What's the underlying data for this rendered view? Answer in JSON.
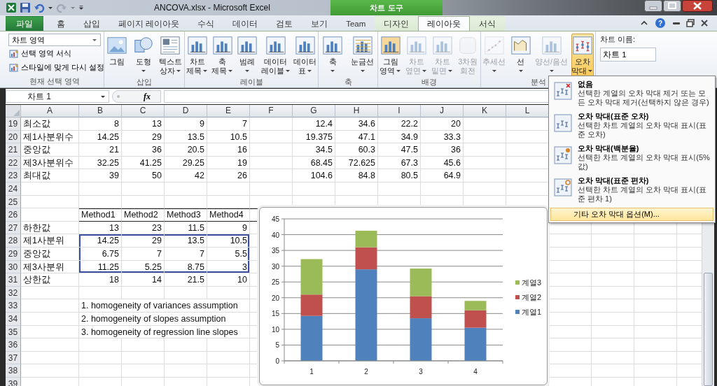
{
  "window": {
    "title": "ANCOVA.xlsx  -  Microsoft Excel",
    "context_group": "차트 도구",
    "help": "?"
  },
  "tabs": [
    {
      "label": "파일",
      "selected": false,
      "kind": "file"
    },
    {
      "label": "홈",
      "selected": false,
      "kind": "main"
    },
    {
      "label": "삽입",
      "selected": false,
      "kind": "main"
    },
    {
      "label": "페이지 레이아웃",
      "selected": false,
      "kind": "main"
    },
    {
      "label": "수식",
      "selected": false,
      "kind": "main"
    },
    {
      "label": "데이터",
      "selected": false,
      "kind": "main"
    },
    {
      "label": "검토",
      "selected": false,
      "kind": "main"
    },
    {
      "label": "보기",
      "selected": false,
      "kind": "main"
    },
    {
      "label": "Team",
      "selected": false,
      "kind": "main"
    },
    {
      "label": "디자인",
      "selected": false,
      "kind": "context"
    },
    {
      "label": "레이아웃",
      "selected": true,
      "kind": "context"
    },
    {
      "label": "서식",
      "selected": false,
      "kind": "context"
    }
  ],
  "ribbon": {
    "selection_group": {
      "label": "현재 선택 영역",
      "dropdown": "차트 영역",
      "items": [
        "선택 영역 서식",
        "스타일에 맞게 다시 설정"
      ]
    },
    "groups": [
      {
        "label": "삽입",
        "buttons": [
          {
            "lines": [
              "그림"
            ],
            "dropdown": false,
            "disabled": false,
            "selected": false
          },
          {
            "lines": [
              "도형"
            ],
            "dropdown": true,
            "disabled": false,
            "selected": false
          },
          {
            "lines": [
              "텍스트",
              "상자"
            ],
            "dropdown": true,
            "disabled": false,
            "selected": false
          }
        ]
      },
      {
        "label": "레이블",
        "buttons": [
          {
            "lines": [
              "차트",
              "제목"
            ],
            "dropdown": true,
            "disabled": false,
            "selected": false
          },
          {
            "lines": [
              "축",
              "제목"
            ],
            "dropdown": true,
            "disabled": false,
            "selected": false
          },
          {
            "lines": [
              "범례"
            ],
            "dropdown": true,
            "disabled": false,
            "selected": false
          },
          {
            "lines": [
              "데이터",
              "레이블"
            ],
            "dropdown": true,
            "disabled": false,
            "selected": false
          },
          {
            "lines": [
              "데이터",
              "표"
            ],
            "dropdown": true,
            "disabled": false,
            "selected": false
          }
        ]
      },
      {
        "label": "축",
        "buttons": [
          {
            "lines": [
              "축"
            ],
            "dropdown": true,
            "disabled": false,
            "selected": false
          },
          {
            "lines": [
              "눈금선"
            ],
            "dropdown": true,
            "disabled": false,
            "selected": false
          }
        ]
      },
      {
        "label": "배경",
        "buttons": [
          {
            "lines": [
              "그림",
              "영역"
            ],
            "dropdown": true,
            "disabled": false,
            "selected": false
          },
          {
            "lines": [
              "차트",
              "옆면"
            ],
            "dropdown": true,
            "disabled": true,
            "selected": false
          },
          {
            "lines": [
              "차트",
              "밑면"
            ],
            "dropdown": true,
            "disabled": true,
            "selected": false
          },
          {
            "lines": [
              "3차원",
              "회전"
            ],
            "dropdown": false,
            "disabled": true,
            "selected": false
          }
        ]
      },
      {
        "label": "분석",
        "buttons": [
          {
            "lines": [
              "추세선"
            ],
            "dropdown": true,
            "disabled": true,
            "selected": false
          },
          {
            "lines": [
              "선"
            ],
            "dropdown": true,
            "disabled": false,
            "selected": false
          },
          {
            "lines": [
              "양선/음선"
            ],
            "dropdown": true,
            "disabled": true,
            "selected": false
          },
          {
            "lines": [
              "오차",
              "막대"
            ],
            "dropdown": true,
            "disabled": false,
            "selected": true
          }
        ]
      }
    ],
    "chart_name": {
      "label": "차트 이름:",
      "value": "차트 1"
    }
  },
  "formula_bar": {
    "name_box": "차트 1",
    "function_label": "fx"
  },
  "sheet": {
    "columns": [
      "A",
      "B",
      "C",
      "D",
      "E",
      "F",
      "G",
      "H",
      "I",
      "J",
      "K",
      "L"
    ],
    "rows": [
      {
        "number": "19",
        "kind": "data",
        "selected": false,
        "cells": {
          "A": "최소값",
          "B": "8",
          "C": "13",
          "D": "9",
          "E": "7",
          "G": "12.4",
          "H": "34.6",
          "I": "22.2",
          "J": "20"
        }
      },
      {
        "number": "20",
        "kind": "data",
        "selected": false,
        "cells": {
          "A": "제1사분위수",
          "B": "14.25",
          "C": "29",
          "D": "13.5",
          "E": "10.5",
          "G": "19.375",
          "H": "47.1",
          "I": "34.9",
          "J": "33.3"
        }
      },
      {
        "number": "21",
        "kind": "data",
        "selected": false,
        "cells": {
          "A": "중앙값",
          "B": "21",
          "C": "36",
          "D": "20.5",
          "E": "16",
          "G": "34.5",
          "H": "60.3",
          "I": "47.5",
          "J": "36"
        }
      },
      {
        "number": "22",
        "kind": "data",
        "selected": false,
        "cells": {
          "A": "제3사분위수",
          "B": "32.25",
          "C": "41.25",
          "D": "29.25",
          "E": "19",
          "G": "68.45",
          "H": "72.625",
          "I": "67.3",
          "J": "45.6"
        }
      },
      {
        "number": "23",
        "kind": "data",
        "selected": false,
        "cells": {
          "A": "최대값",
          "B": "39",
          "C": "50",
          "D": "42",
          "E": "26",
          "G": "104.6",
          "H": "84.8",
          "I": "80.5",
          "J": "64.9"
        }
      },
      {
        "number": "24",
        "kind": "data",
        "selected": false,
        "cells": {}
      },
      {
        "number": "25",
        "kind": "data",
        "selected": false,
        "cells": {}
      },
      {
        "number": "26",
        "kind": "header",
        "selected": false,
        "cells": {
          "B": "Method1",
          "C": "Method2",
          "D": "Method3",
          "E": "Method4"
        }
      },
      {
        "number": "27",
        "kind": "data",
        "selected": false,
        "cells": {
          "A": "하한값",
          "B": "13",
          "C": "23",
          "D": "11.5",
          "E": "9"
        }
      },
      {
        "number": "28",
        "kind": "data",
        "selected": true,
        "cells": {
          "A": "제1사분위",
          "B": "14.25",
          "C": "29",
          "D": "13.5",
          "E": "10.5"
        }
      },
      {
        "number": "29",
        "kind": "data",
        "selected": true,
        "cells": {
          "A": "중앙값",
          "B": "6.75",
          "C": "7",
          "D": "7",
          "E": "5.5"
        }
      },
      {
        "number": "30",
        "kind": "data",
        "selected": true,
        "cells": {
          "A": "제3사분위",
          "B": "11.25",
          "C": "5.25",
          "D": "8.75",
          "E": "3"
        }
      },
      {
        "number": "31",
        "kind": "data",
        "selected": false,
        "cells": {
          "A": "상한값",
          "B": "18",
          "C": "14",
          "D": "21.5",
          "E": "10"
        }
      },
      {
        "number": "32",
        "kind": "data",
        "selected": false,
        "cells": {}
      },
      {
        "number": "33",
        "kind": "note",
        "selected": false,
        "cells": {
          "B": "1. homogeneity of variances assumption"
        }
      },
      {
        "number": "34",
        "kind": "note",
        "selected": false,
        "cells": {
          "B": "2. homogeneity of slopes assumption"
        }
      },
      {
        "number": "35",
        "kind": "note",
        "selected": false,
        "cells": {
          "B": "3. homogeneity of regression line slopes"
        }
      },
      {
        "number": "36",
        "kind": "data",
        "selected": false,
        "cells": {}
      },
      {
        "number": "37",
        "kind": "data",
        "selected": false,
        "cells": {}
      },
      {
        "number": "38",
        "kind": "data",
        "selected": false,
        "cells": {}
      },
      {
        "number": "39",
        "kind": "data",
        "selected": false,
        "cells": {}
      }
    ]
  },
  "chart": {
    "chart_data": {
      "type": "bar",
      "stacked": true,
      "categories": [
        "1",
        "2",
        "3",
        "4"
      ],
      "series": [
        {
          "name": "계열1",
          "color": "#4f81bd",
          "values": [
            14.25,
            29,
            13.5,
            10.5
          ]
        },
        {
          "name": "계열2",
          "color": "#c0504d",
          "values": [
            6.75,
            7,
            7,
            5.5
          ]
        },
        {
          "name": "계열3",
          "color": "#9bbb59",
          "values": [
            11.25,
            5.25,
            8.75,
            3
          ]
        }
      ],
      "grid": true,
      "legend": "right",
      "ylim": [
        0,
        45
      ],
      "yticks": [
        {
          "value": 0,
          "label": "0"
        },
        {
          "value": 5,
          "label": "5"
        },
        {
          "value": 10,
          "label": "10"
        },
        {
          "value": 15,
          "label": "15"
        },
        {
          "value": 20,
          "label": "20"
        },
        {
          "value": 25,
          "label": "25"
        },
        {
          "value": 30,
          "label": "30"
        },
        {
          "value": 35,
          "label": "35"
        },
        {
          "value": 40,
          "label": "40"
        },
        {
          "value": 45,
          "label": "45"
        }
      ]
    }
  },
  "menu": {
    "items": [
      {
        "title": "없음",
        "description": "선택한 계열의 오차 막대 제거 또는 모든 오차 막대 제거(선택하지 않은 경우)",
        "selected": false
      },
      {
        "title": "오차 막대(표준 오차)",
        "description": "선택한 차트 계열의 오차 막대 표시(표준 오차)",
        "selected": false
      },
      {
        "title": "오차 막대(백분율)",
        "description": "선택한 차트 계열의 오차 막대 표시(5% 값)",
        "selected": false
      },
      {
        "title": "오차 막대(표준 편차)",
        "description": "선택한 차트 계열의 오차 막대 표시(표준 편차 1)",
        "selected": false
      }
    ],
    "footer": {
      "label": "기타 오차 막대 옵션(M)...",
      "selected": true
    }
  }
}
